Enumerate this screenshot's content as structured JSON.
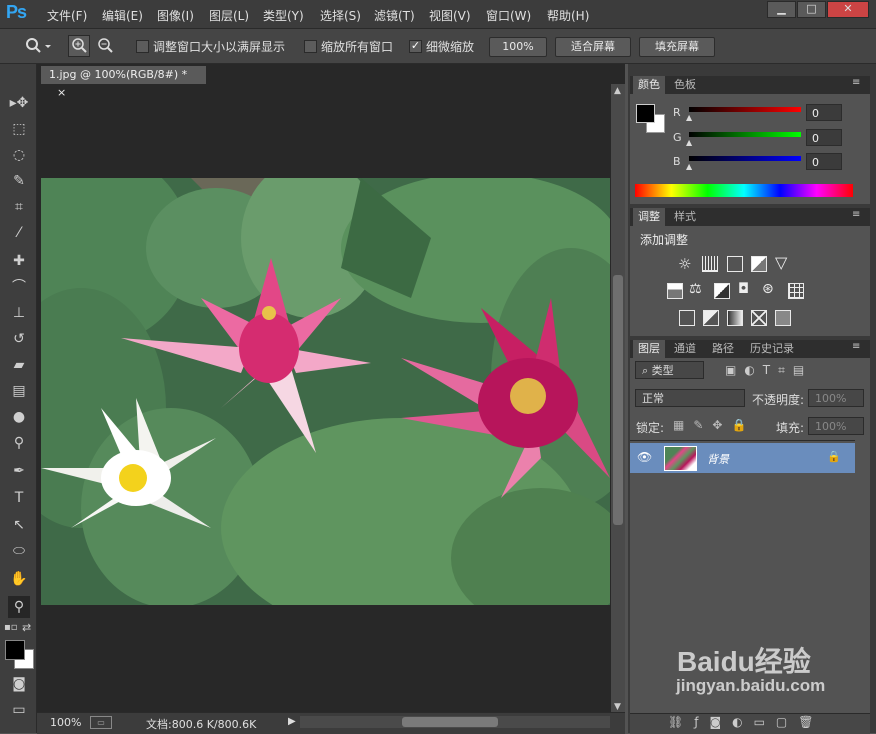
{
  "app": {
    "logo": "Ps"
  },
  "menu": [
    "文件(F)",
    "编辑(E)",
    "图像(I)",
    "图层(L)",
    "类型(Y)",
    "选择(S)",
    "滤镜(T)",
    "视图(V)",
    "窗口(W)",
    "帮助(H)"
  ],
  "window_controls": {
    "minimize": "▁",
    "maximize": "□",
    "close": "✕"
  },
  "options": {
    "resize_windows_label": "调整窗口大小以满屏显示",
    "resize_windows_checked": false,
    "zoom_all_label": "缩放所有窗口",
    "zoom_all_checked": false,
    "scrubby_zoom_label": "细微缩放",
    "scrubby_zoom_checked": true,
    "btn_100": "100%",
    "btn_fit": "适合屏幕",
    "btn_fill": "填充屏幕"
  },
  "document": {
    "tab_title": "1.jpg @ 100%(RGB/8#) *",
    "tab_close": "×"
  },
  "status": {
    "zoom": "100%",
    "doc_info": "文档:800.6 K/800.6K"
  },
  "color_panel": {
    "tabs": [
      "颜色",
      "色板"
    ],
    "r_label": "R",
    "g_label": "G",
    "b_label": "B",
    "r_value": "0",
    "g_value": "0",
    "b_value": "0",
    "foreground": "#000000",
    "background": "#ffffff"
  },
  "adjust_panel": {
    "tabs": [
      "调整",
      "样式"
    ],
    "heading": "添加调整"
  },
  "layers_panel": {
    "tabs": [
      "图层",
      "通道",
      "路径",
      "历史记录"
    ],
    "filter_kind": "类型",
    "blend_mode": "正常",
    "opacity_label": "不透明度:",
    "opacity_value": "100%",
    "lock_label": "锁定:",
    "fill_label": "填充:",
    "fill_value": "100%",
    "layers": [
      {
        "name": "背景",
        "visible": true,
        "locked": true
      }
    ]
  },
  "watermark": {
    "brand": "Baidu经验",
    "url": "jingyan.baidu.com"
  },
  "colors": {
    "accent": "#33a6f3",
    "selected_layer": "#6a8dbd"
  }
}
